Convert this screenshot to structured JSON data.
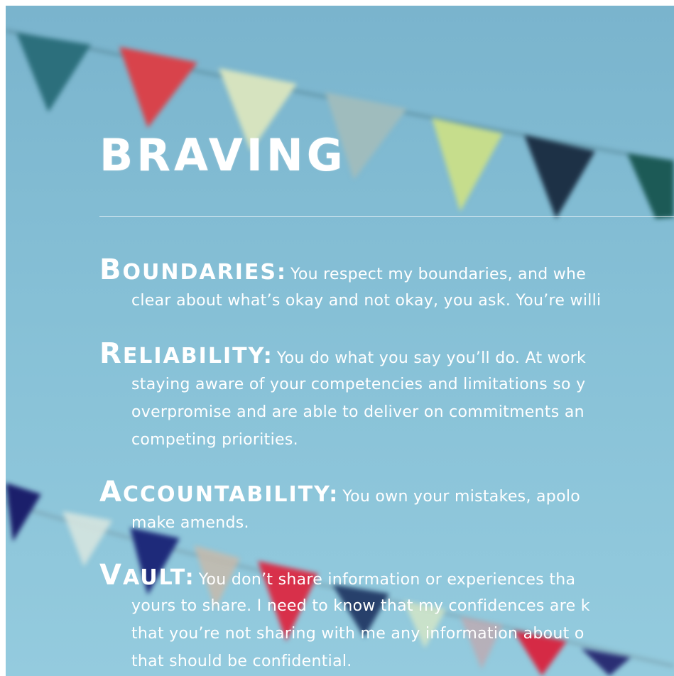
{
  "colors": {
    "sky": "#86c0d6",
    "text": "#ffffff"
  },
  "title": "BRAVING",
  "items": [
    {
      "initial": "B",
      "rest": "OUNDARIES:",
      "first_line": "You respect my boundaries, and whe",
      "lines": [
        "clear about what’s okay and not okay, you ask. You’re willi"
      ]
    },
    {
      "initial": "R",
      "rest": "ELIABILITY:",
      "first_line": "You do what you say you’ll do. At work",
      "lines": [
        "staying aware of your competencies and limitations so y",
        "overpromise and are able to deliver on commitments an",
        "competing priorities."
      ]
    },
    {
      "initial": "A",
      "rest": "CCOUNTABILITY:",
      "first_line": "You own your mistakes, apolo",
      "lines": [
        "make amends."
      ]
    },
    {
      "initial": "V",
      "rest": "AULT:",
      "first_line": "You don’t share information or experiences tha",
      "lines": [
        "yours to share. I need to know that my confidences are k",
        "that you’re not sharing with me any information about o",
        "that should be confidential."
      ]
    }
  ]
}
